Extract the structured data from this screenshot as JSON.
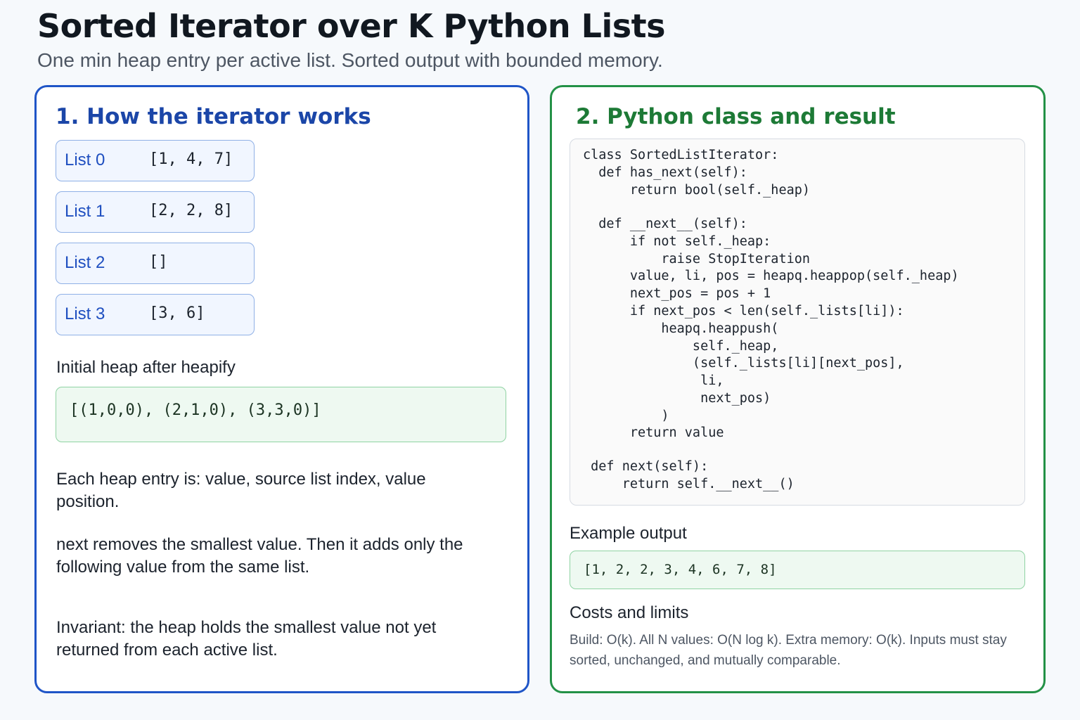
{
  "header": {
    "title": "Sorted Iterator over K Python Lists",
    "subtitle": "One min heap entry per active list. Sorted output with bounded memory."
  },
  "left": {
    "heading": "1. How the iterator works",
    "lists": [
      {
        "label": "List 0",
        "values": "[1, 4, 7]"
      },
      {
        "label": "List 1",
        "values": "[2, 2, 8]"
      },
      {
        "label": "List 2",
        "values": "[]"
      },
      {
        "label": "List 3",
        "values": "[3, 6]"
      }
    ],
    "heap_label": "Initial heap after heapify",
    "heap_value": "[(1,0,0), (2,1,0), (3,3,0)]",
    "para1": "Each heap entry is: value, source list index, value position.",
    "para2": "next removes the smallest value. Then it adds only the following value from the same list.",
    "para3": "Invariant: the heap holds the smallest value not yet returned from each active list."
  },
  "right": {
    "heading": "2. Python class and result",
    "code": [
      "class SortedListIterator:",
      "  def has_next(self):",
      "      return bool(self._heap)",
      "",
      "  def __next__(self):",
      "      if not self._heap:",
      "          raise StopIteration",
      "      value, li, pos = heapq.heappop(self._heap)",
      "      next_pos = pos + 1",
      "      if next_pos < len(self._lists[li]):",
      "          heapq.heappush(",
      "              self._heap,",
      "              (self._lists[li][next_pos],",
      "               li,",
      "               next_pos)",
      "          )",
      "      return value",
      "",
      " def next(self):",
      "     return self.__next__()"
    ],
    "output_label": "Example output",
    "output_value": "[1, 2, 2, 3, 4, 6, 7, 8]",
    "costs_label": "Costs and limits",
    "costs_text": "Build: O(k). All N values: O(N log k). Extra memory: O(k). Inputs must stay sorted, unchanged, and mutually comparable."
  },
  "colors": {
    "left_accent": "#1f55c7",
    "right_accent": "#239146",
    "heap_fill": "#eef9f1"
  }
}
